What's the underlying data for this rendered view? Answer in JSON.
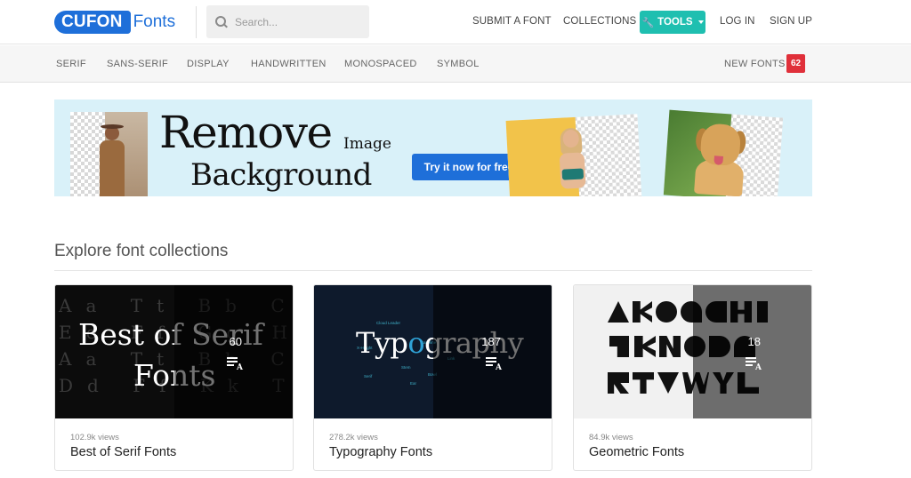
{
  "header": {
    "logo_badge": "CUFON",
    "logo_word": "Fonts",
    "search_placeholder": "Search...",
    "nav": {
      "submit": "SUBMIT A FONT",
      "collections": "COLLECTIONS",
      "tools": "TOOLS",
      "login": "LOG IN",
      "signup": "SIGN UP"
    }
  },
  "categories": {
    "items": [
      "SERIF",
      "SANS-SERIF",
      "DISPLAY",
      "HANDWRITTEN",
      "MONOSPACED",
      "SYMBOL"
    ],
    "new_fonts_label": "NEW FONTS",
    "new_fonts_count": "62"
  },
  "banner": {
    "title_line1": "Remove",
    "title_small": "Image",
    "title_line2": "Background",
    "cta": "Try it now for free"
  },
  "section": {
    "title": "Explore font collections"
  },
  "collections": [
    {
      "name": "Best of Serif Fonts",
      "views": "102.9k views",
      "count": "60",
      "cover_line1": "Best of Serif",
      "cover_line2": "Fonts"
    },
    {
      "name": "Typography Fonts",
      "views": "278.2k views",
      "count": "187",
      "cover_word_pre": "Typ",
      "cover_word_o": "o",
      "cover_word_post": "graphy"
    },
    {
      "name": "Geometric Fonts",
      "views": "84.9k views",
      "count": "18"
    }
  ],
  "colors": {
    "brand_blue": "#1e6fd9",
    "tools_teal": "#1fbfb0",
    "badge_red": "#e0303a",
    "banner_bg": "#d9f1f9"
  },
  "icons": {
    "search": "search-icon",
    "tools": "wrench-icon",
    "dropdown": "caret-down-icon",
    "font_list": "font-list-icon"
  }
}
